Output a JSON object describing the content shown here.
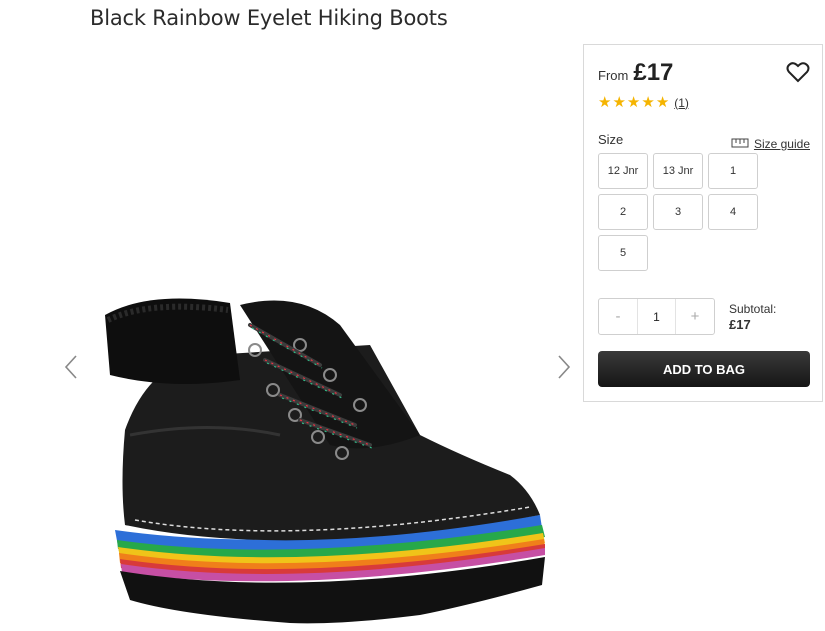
{
  "product": {
    "title": "Black Rainbow Eyelet Hiking Boots"
  },
  "gallery": {
    "prev_icon": "chevron-left-icon",
    "next_icon": "chevron-right-icon"
  },
  "panel": {
    "from_label": "From",
    "price": "£17",
    "rating": {
      "stars": 5,
      "max": 5,
      "count_label": "(1)",
      "color": "#f5b400"
    },
    "wishlist_icon": "heart-icon",
    "size_label": "Size",
    "size_guide_label": "Size guide",
    "sizes": [
      "12 Jnr",
      "13 Jnr",
      "1",
      "2",
      "3",
      "4",
      "5"
    ],
    "quantity": {
      "minus": "-",
      "value": "1",
      "plus": "+"
    },
    "subtotal_label": "Subtotal:",
    "subtotal_value": "£17",
    "add_to_bag_label": "ADD TO BAG"
  }
}
